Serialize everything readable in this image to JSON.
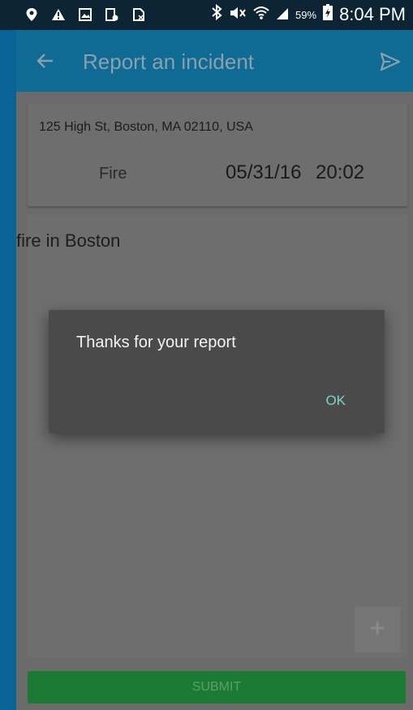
{
  "status_bar": {
    "left_icons": [
      "location-icon",
      "warning-icon",
      "image-icon",
      "screenshot-icon",
      "no-sim-icon"
    ],
    "right_icons": [
      "bluetooth-icon",
      "mute-icon",
      "wifi-icon",
      "signal-icon",
      "battery-icon"
    ],
    "battery_percent": "59%",
    "time": "8:04 PM"
  },
  "app_bar": {
    "title": "Report an incident",
    "back_icon": "arrow-left-icon",
    "send_icon": "send-icon"
  },
  "incident": {
    "address": "125 High St, Boston, MA 02110, USA",
    "type": "Fire",
    "date": "05/31/16",
    "time": "20:02",
    "description": "fire in Boston"
  },
  "fab": {
    "icon": "add-icon"
  },
  "submit": {
    "label": "SUBMIT"
  },
  "dialog": {
    "message": "Thanks for your report",
    "ok_label": "OK"
  },
  "colors": {
    "status_bar": "#0c2433",
    "app_bar": "#0f6b94",
    "side": "#0a6396",
    "submit": "#1b7a34",
    "dialog": "#4a4a4a",
    "ok": "#7fd2c6"
  }
}
